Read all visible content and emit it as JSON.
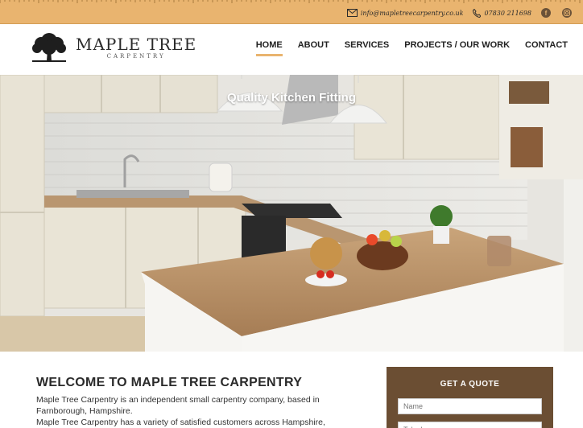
{
  "topbar": {
    "email": "info@mapletreecarpentry.co.uk",
    "phone": "07830 211698",
    "social": [
      "facebook",
      "instagram"
    ]
  },
  "logo": {
    "title": "MAPLE TREE",
    "subtitle": "CARPENTRY"
  },
  "nav": {
    "items": [
      {
        "label": "HOME",
        "active": true
      },
      {
        "label": "ABOUT"
      },
      {
        "label": "SERVICES"
      },
      {
        "label": "PROJECTS / OUR WORK"
      },
      {
        "label": "CONTACT"
      }
    ]
  },
  "hero": {
    "title": "Quality Kitchen Fitting"
  },
  "welcome": {
    "title": "WELCOME TO MAPLE TREE CARPENTRY",
    "line1": "Maple Tree Carpentry is an independent small carpentry company, based in",
    "line2": "Farnborough, Hampshire.",
    "line3": "Maple Tree Carpentry has a variety of satisfied customers across Hampshire,"
  },
  "quote": {
    "title": "GET A QUOTE",
    "name_placeholder": "Name",
    "phone_placeholder": "Telephone"
  },
  "colors": {
    "accent": "#e9b46f",
    "brown": "#6b4e33"
  }
}
